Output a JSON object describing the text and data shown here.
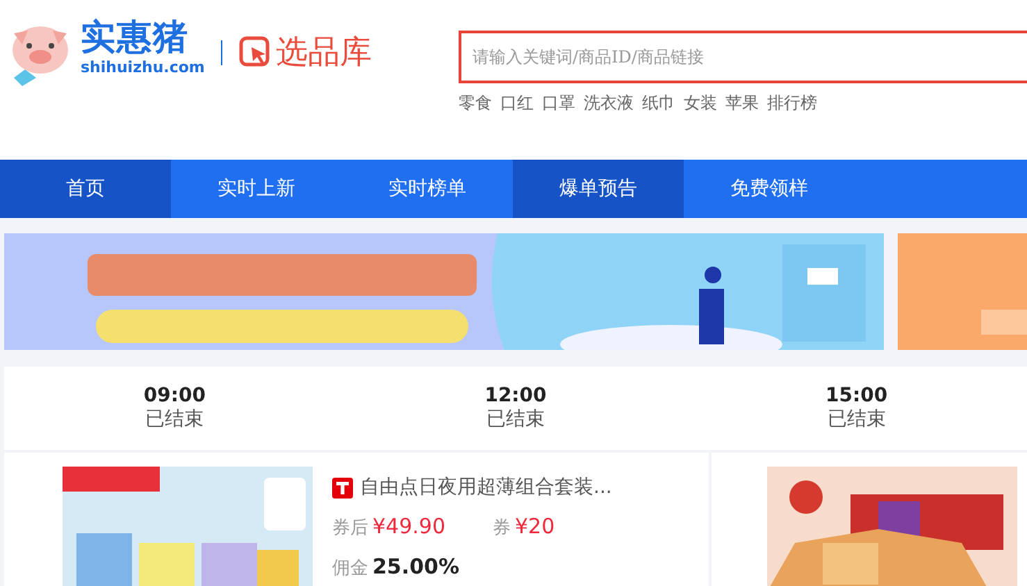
{
  "logo": {
    "name": "实惠猪",
    "domain": "shihuizhu.com",
    "product": "选品库"
  },
  "search": {
    "placeholder": "请输入关键词/商品ID/商品链接"
  },
  "hot_words": [
    "零食",
    "口红",
    "口罩",
    "洗衣液",
    "纸巾",
    "女装",
    "苹果",
    "排行榜"
  ],
  "nav": [
    {
      "label": "首页",
      "selected": true
    },
    {
      "label": "实时上新",
      "selected": false
    },
    {
      "label": "实时榜单",
      "selected": false
    },
    {
      "label": "爆单预告",
      "selected": true
    },
    {
      "label": "免费领样",
      "selected": false
    }
  ],
  "sessions": [
    {
      "time": "09:00",
      "status": "已结束"
    },
    {
      "time": "12:00",
      "status": "已结束"
    },
    {
      "time": "15:00",
      "status": "已结束"
    }
  ],
  "products": [
    {
      "kind": "full",
      "title": "自由点日夜用超薄组合套装...",
      "price_label": "券后",
      "price": "¥49.90",
      "coupon_label": "券",
      "coupon": "¥20",
      "commission_label": "佣金",
      "commission": "25.00%"
    },
    {
      "kind": "image-only"
    }
  ]
}
